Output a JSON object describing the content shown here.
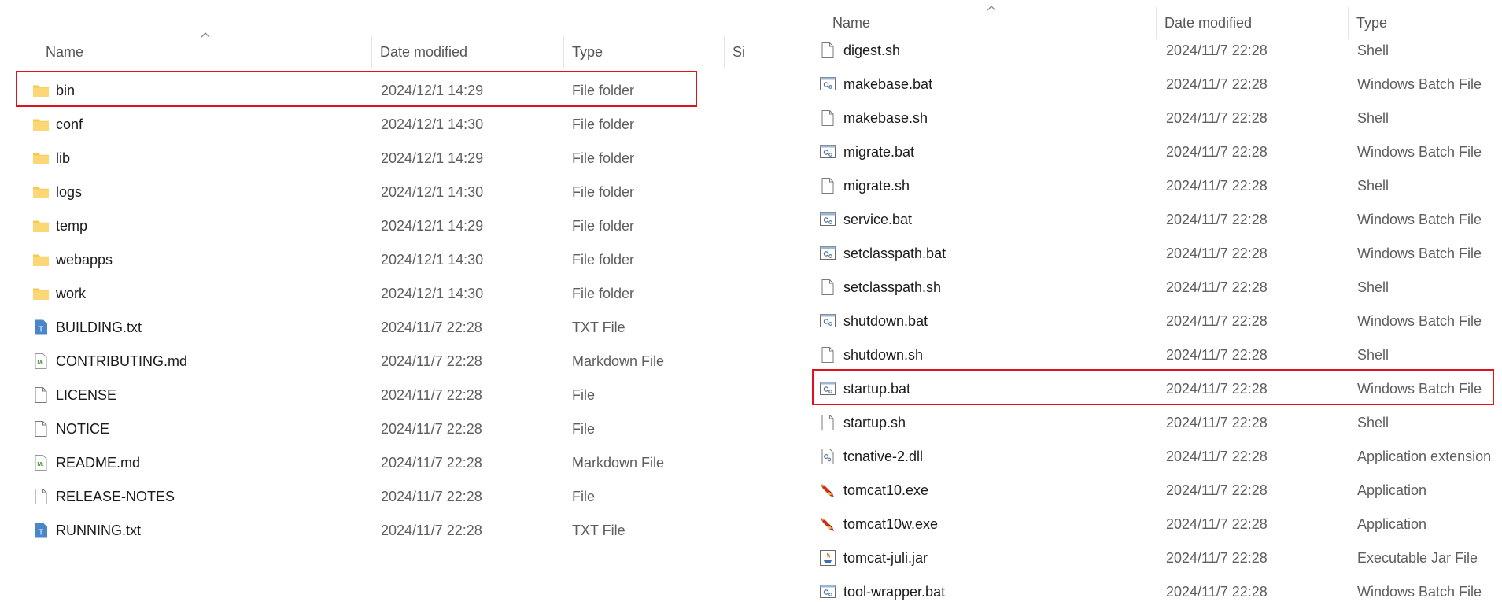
{
  "left_pane": {
    "columns": {
      "name": "Name",
      "date": "Date modified",
      "type": "Type",
      "size": "Si"
    },
    "rows": [
      {
        "name": "bin",
        "date": "2024/12/1 14:29",
        "type": "File folder",
        "icon": "folder-icon",
        "highlighted": true
      },
      {
        "name": "conf",
        "date": "2024/12/1 14:30",
        "type": "File folder",
        "icon": "folder-icon"
      },
      {
        "name": "lib",
        "date": "2024/12/1 14:29",
        "type": "File folder",
        "icon": "folder-icon"
      },
      {
        "name": "logs",
        "date": "2024/12/1 14:30",
        "type": "File folder",
        "icon": "folder-icon"
      },
      {
        "name": "temp",
        "date": "2024/12/1 14:29",
        "type": "File folder",
        "icon": "folder-icon"
      },
      {
        "name": "webapps",
        "date": "2024/12/1 14:30",
        "type": "File folder",
        "icon": "folder-icon"
      },
      {
        "name": "work",
        "date": "2024/12/1 14:30",
        "type": "File folder",
        "icon": "folder-icon"
      },
      {
        "name": "BUILDING.txt",
        "date": "2024/11/7 22:28",
        "type": "TXT File",
        "icon": "text-file-icon"
      },
      {
        "name": "CONTRIBUTING.md",
        "date": "2024/11/7 22:28",
        "type": "Markdown File",
        "icon": "markdown-file-icon"
      },
      {
        "name": "LICENSE",
        "date": "2024/11/7 22:28",
        "type": "File",
        "icon": "file-icon"
      },
      {
        "name": "NOTICE",
        "date": "2024/11/7 22:28",
        "type": "File",
        "icon": "file-icon"
      },
      {
        "name": "README.md",
        "date": "2024/11/7 22:28",
        "type": "Markdown File",
        "icon": "markdown-file-icon"
      },
      {
        "name": "RELEASE-NOTES",
        "date": "2024/11/7 22:28",
        "type": "File",
        "icon": "file-icon"
      },
      {
        "name": "RUNNING.txt",
        "date": "2024/11/7 22:28",
        "type": "TXT File",
        "icon": "text-file-icon"
      }
    ]
  },
  "right_pane": {
    "columns": {
      "name": "Name",
      "date": "Date modified",
      "type": "Type"
    },
    "rows": [
      {
        "name": "digest.sh",
        "date": "2024/11/7 22:28",
        "type": "Shell",
        "icon": "file-icon"
      },
      {
        "name": "makebase.bat",
        "date": "2024/11/7 22:28",
        "type": "Windows Batch File",
        "icon": "batch-file-icon"
      },
      {
        "name": "makebase.sh",
        "date": "2024/11/7 22:28",
        "type": "Shell",
        "icon": "file-icon"
      },
      {
        "name": "migrate.bat",
        "date": "2024/11/7 22:28",
        "type": "Windows Batch File",
        "icon": "batch-file-icon"
      },
      {
        "name": "migrate.sh",
        "date": "2024/11/7 22:28",
        "type": "Shell",
        "icon": "file-icon"
      },
      {
        "name": "service.bat",
        "date": "2024/11/7 22:28",
        "type": "Windows Batch File",
        "icon": "batch-file-icon"
      },
      {
        "name": "setclasspath.bat",
        "date": "2024/11/7 22:28",
        "type": "Windows Batch File",
        "icon": "batch-file-icon"
      },
      {
        "name": "setclasspath.sh",
        "date": "2024/11/7 22:28",
        "type": "Shell",
        "icon": "file-icon"
      },
      {
        "name": "shutdown.bat",
        "date": "2024/11/7 22:28",
        "type": "Windows Batch File",
        "icon": "batch-file-icon"
      },
      {
        "name": "shutdown.sh",
        "date": "2024/11/7 22:28",
        "type": "Shell",
        "icon": "file-icon"
      },
      {
        "name": "startup.bat",
        "date": "2024/11/7 22:28",
        "type": "Windows Batch File",
        "icon": "batch-file-icon",
        "highlighted": true
      },
      {
        "name": "startup.sh",
        "date": "2024/11/7 22:28",
        "type": "Shell",
        "icon": "file-icon"
      },
      {
        "name": "tcnative-2.dll",
        "date": "2024/11/7 22:28",
        "type": "Application extension",
        "icon": "dll-file-icon"
      },
      {
        "name": "tomcat10.exe",
        "date": "2024/11/7 22:28",
        "type": "Application",
        "icon": "tomcat-exe-icon"
      },
      {
        "name": "tomcat10w.exe",
        "date": "2024/11/7 22:28",
        "type": "Application",
        "icon": "tomcat-exe-icon"
      },
      {
        "name": "tomcat-juli.jar",
        "date": "2024/11/7 22:28",
        "type": "Executable Jar File",
        "icon": "jar-file-icon"
      },
      {
        "name": "tool-wrapper.bat",
        "date": "2024/11/7 22:28",
        "type": "Windows Batch File",
        "icon": "batch-file-icon"
      }
    ]
  },
  "colors": {
    "highlight": "#e1121c",
    "folder": "#f8c94c",
    "text_file": "#4a86c8"
  }
}
